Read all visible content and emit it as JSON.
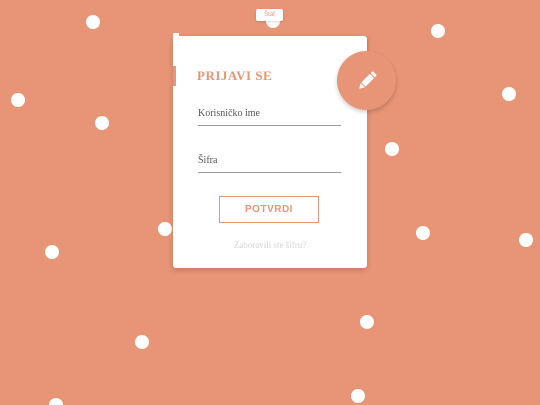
{
  "colors": {
    "background": "#e89476",
    "accent": "#e89476",
    "card": "#ffffff",
    "dots": "#ffffff"
  },
  "top_tag": {
    "label": "Štáf"
  },
  "login_card": {
    "title": "PRIJAVI SE",
    "username_label": "Korisničko ime",
    "password_label": "Šifra",
    "submit_label": "POTVRDI",
    "forgot_label": "Zaboravili ste šifru?"
  },
  "icons": {
    "edit_button": "pencil-icon"
  }
}
